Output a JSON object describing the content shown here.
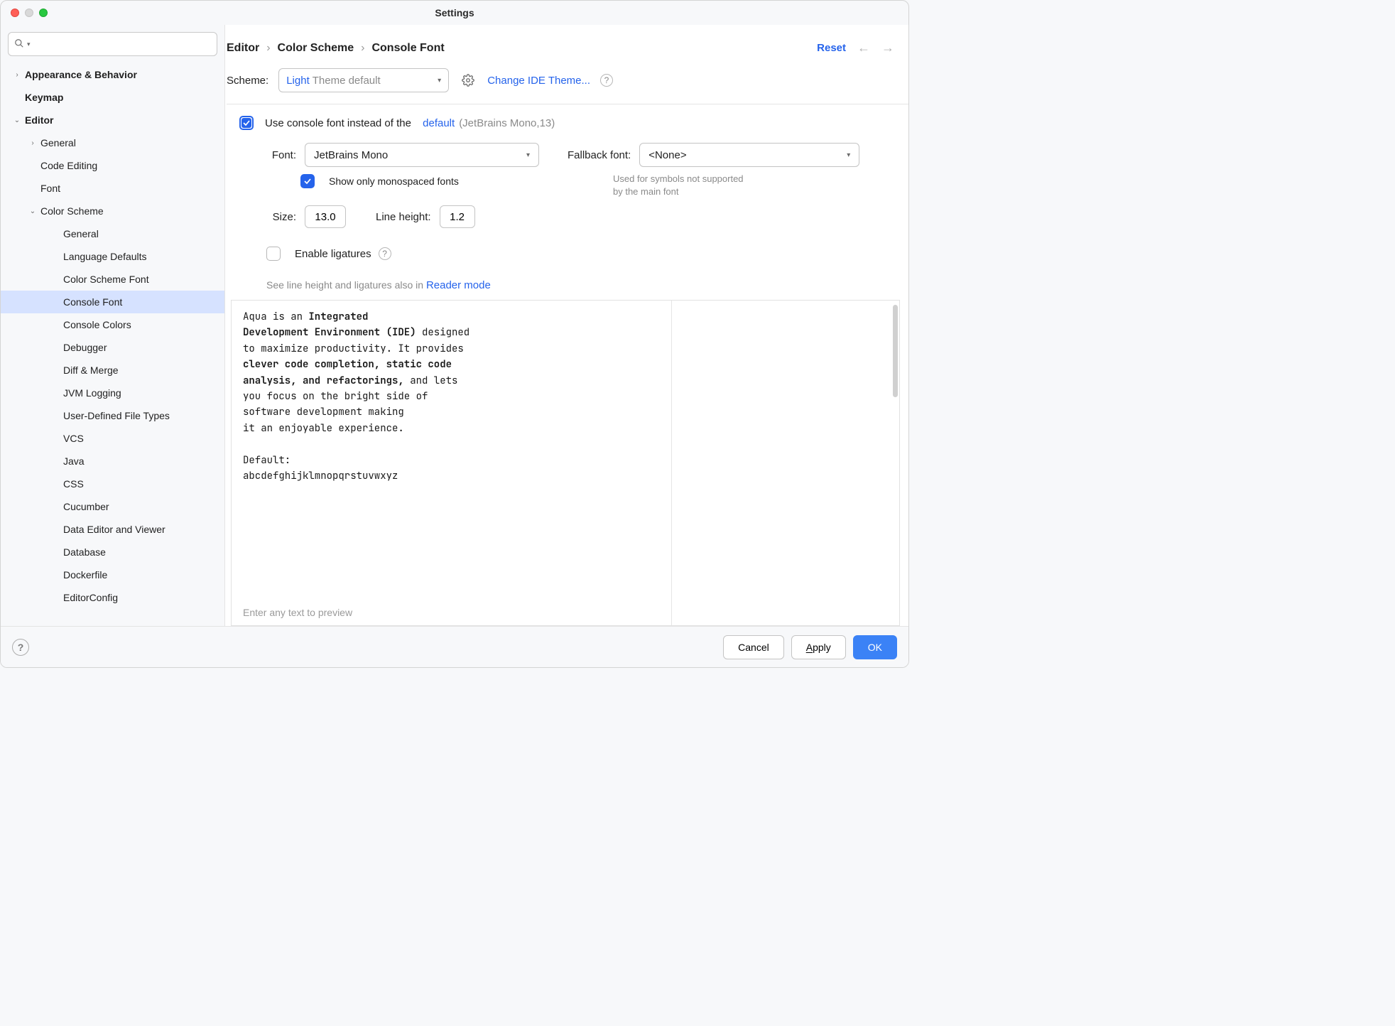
{
  "window": {
    "title": "Settings"
  },
  "search": {
    "placeholder": ""
  },
  "tree": {
    "appearance": "Appearance & Behavior",
    "keymap": "Keymap",
    "editor": "Editor",
    "general": "General",
    "code_editing": "Code Editing",
    "font": "Font",
    "color_scheme": "Color Scheme",
    "cs_general": "General",
    "cs_lang_defaults": "Language Defaults",
    "cs_font": "Color Scheme Font",
    "cs_console_font": "Console Font",
    "cs_console_colors": "Console Colors",
    "cs_debugger": "Debugger",
    "cs_diff": "Diff & Merge",
    "cs_jvm": "JVM Logging",
    "cs_udft": "User-Defined File Types",
    "cs_vcs": "VCS",
    "cs_java": "Java",
    "cs_css": "CSS",
    "cs_cucumber": "Cucumber",
    "cs_data_editor": "Data Editor and Viewer",
    "cs_database": "Database",
    "cs_dockerfile": "Dockerfile",
    "cs_editorconfig": "EditorConfig"
  },
  "breadcrumb": {
    "a": "Editor",
    "b": "Color Scheme",
    "c": "Console Font"
  },
  "header": {
    "reset": "Reset"
  },
  "scheme": {
    "label": "Scheme:",
    "value_highlight": "Light",
    "value_rest": "Theme default",
    "change_theme": "Change IDE Theme..."
  },
  "use_console": {
    "label": "Use console font instead of the",
    "link": "default",
    "muted": "(JetBrains Mono,13)"
  },
  "font": {
    "label": "Font:",
    "value": "JetBrains Mono",
    "mono_only": "Show only monospaced fonts"
  },
  "fallback": {
    "label": "Fallback font:",
    "value": "<None>",
    "hint1": "Used for symbols not supported",
    "hint2": "by the main font"
  },
  "size": {
    "label": "Size:",
    "value": "13.0"
  },
  "lineheight": {
    "label": "Line height:",
    "value": "1.2"
  },
  "ligatures": {
    "label": "Enable ligatures"
  },
  "reader": {
    "pre": "See line height and ligatures also in ",
    "link": "Reader mode"
  },
  "preview": {
    "p1a": "Aqua is an ",
    "p1b": "Integrated",
    "p2a": "Development Environment (IDE)",
    "p2b": " designed",
    "p3": "to maximize productivity. It provides",
    "p4": "clever code completion, static code",
    "p5a": "analysis, and refactorings,",
    "p5b": " and lets",
    "p6": "you focus on the bright side of",
    "p7": "software development making",
    "p8": "it an enjoyable experience.",
    "p9": "Default:",
    "p10": "abcdefghijklmnopqrstuvwxyz",
    "placeholder": "Enter any text to preview"
  },
  "footer": {
    "cancel": "Cancel",
    "apply": "Apply",
    "ok": "OK"
  }
}
